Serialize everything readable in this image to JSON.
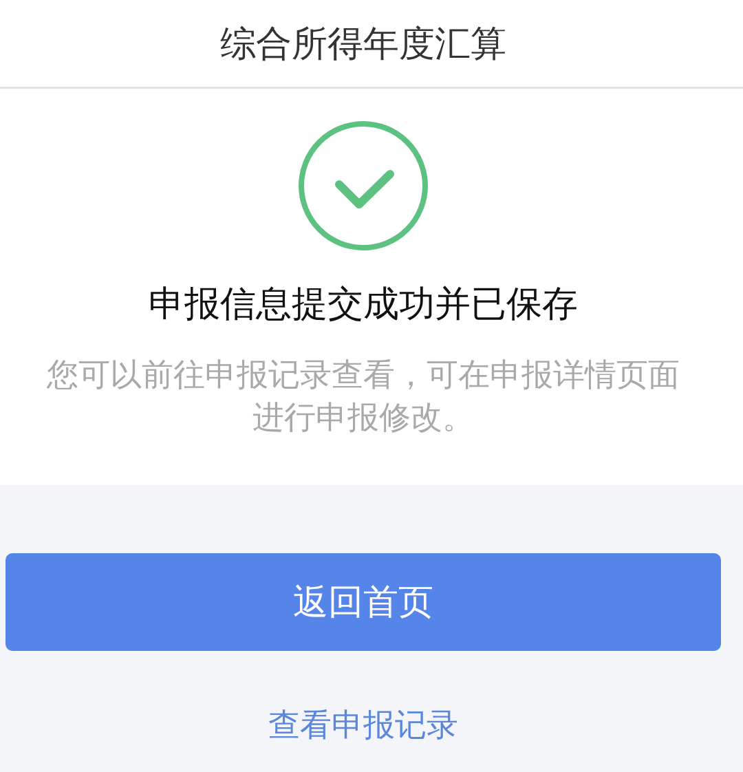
{
  "header": {
    "title": "综合所得年度汇算"
  },
  "result": {
    "kind": "success",
    "title": "申报信息提交成功并已保存",
    "description": "您可以前往申报记录查看，可在申报详情页面进行申报修改。"
  },
  "actions": [
    {
      "kind": "primary",
      "label": "返回首页"
    },
    {
      "kind": "link",
      "label": "查看申报记录"
    }
  ]
}
